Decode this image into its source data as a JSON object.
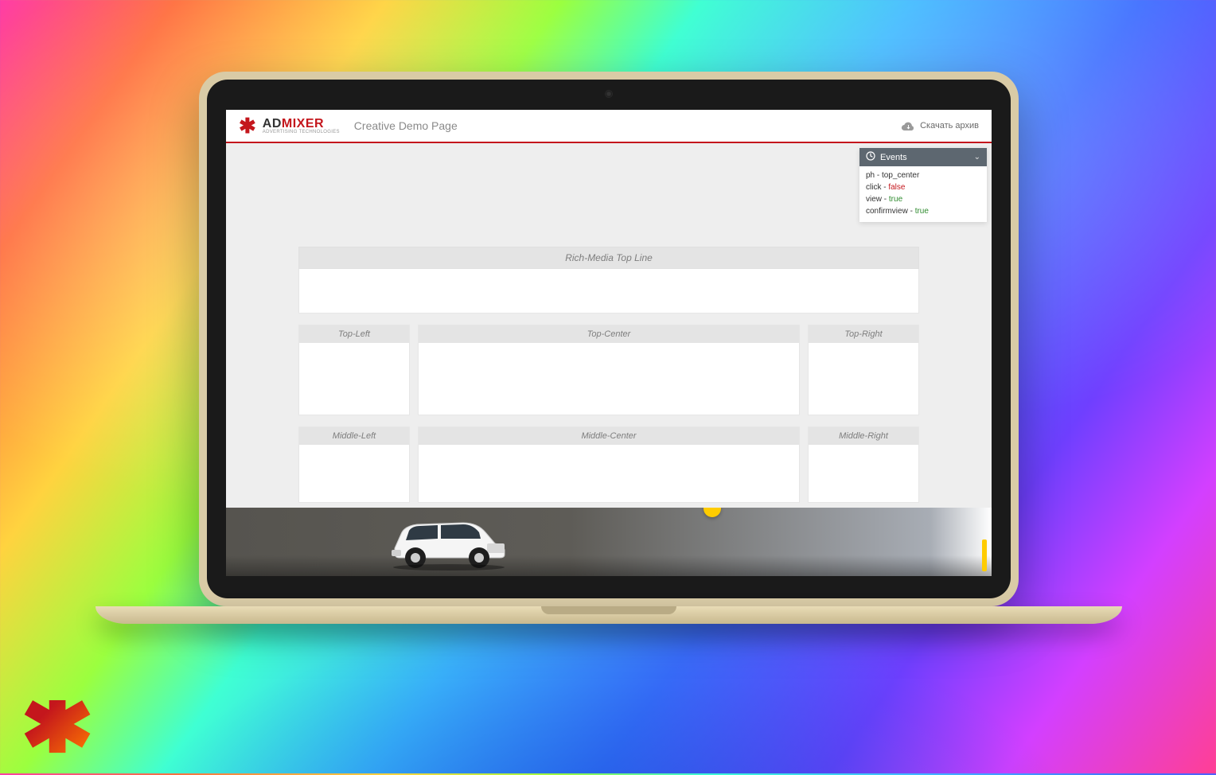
{
  "brand": {
    "ad": "AD",
    "mixer": "MIXER",
    "tagline": "ADVERTISING TECHNOLOGIES"
  },
  "header": {
    "title": "Creative Demo Page",
    "download_label": "Скачать архив"
  },
  "events_panel": {
    "title": "Events",
    "rows": [
      {
        "key": "ph",
        "sep": " - ",
        "value": "top_center",
        "cls": ""
      },
      {
        "key": "click",
        "sep": " - ",
        "value": "false",
        "cls": "ev-false"
      },
      {
        "key": "view",
        "sep": " - ",
        "value": "true",
        "cls": "ev-true"
      },
      {
        "key": "confirmview",
        "sep": " - ",
        "value": "true",
        "cls": "ev-true"
      }
    ]
  },
  "slots": {
    "rich_top": "Rich-Media Top Line",
    "top_left": "Top-Left",
    "top_center": "Top-Center",
    "top_right": "Top-Right",
    "mid_left": "Middle-Left",
    "mid_center": "Middle-Center",
    "mid_right": "Middle-Right"
  },
  "ad": {
    "toggle_glyph": "﹀"
  }
}
